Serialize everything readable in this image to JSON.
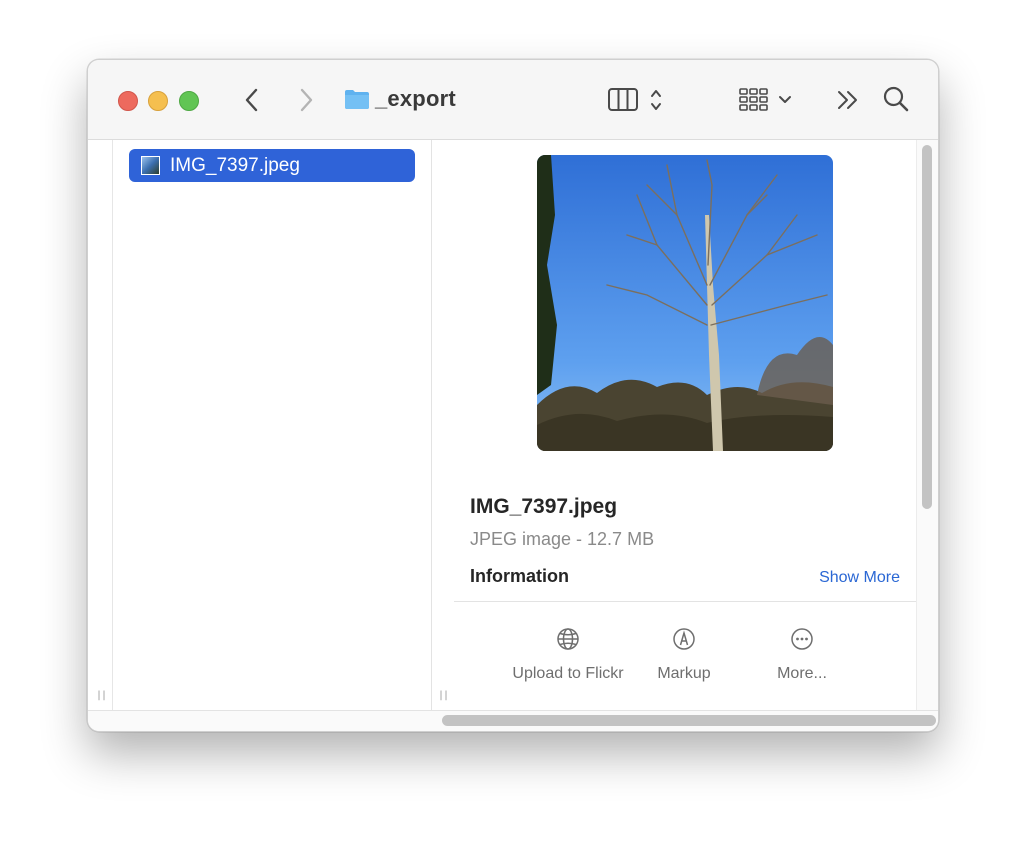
{
  "window": {
    "title": "_export"
  },
  "toolbar": {
    "back_icon": "chevron-left-icon",
    "forward_icon": "chevron-right-icon",
    "folder_icon": "folder-icon",
    "view_icon": "column-view-icon",
    "group_icon": "grid-group-icon",
    "overflow_icon": "double-chevron-right-icon",
    "search_icon": "search-icon"
  },
  "columns": {
    "files": [
      {
        "name": "IMG_7397.jpeg",
        "selected": true
      }
    ]
  },
  "preview": {
    "file_name": "IMG_7397.jpeg",
    "file_meta": "JPEG image - 12.7 MB",
    "info_heading": "Information",
    "show_more": "Show More",
    "actions": [
      {
        "label": "Upload to Flickr",
        "icon": "globe-icon"
      },
      {
        "label": "Markup",
        "icon": "markup-pen-icon"
      },
      {
        "label": "More...",
        "icon": "ellipsis-circle-icon"
      }
    ]
  },
  "colors": {
    "selection": "#2f63d8",
    "link": "#2a67d4",
    "close": "#ed6a5e",
    "minimize": "#f5bf4f",
    "zoom": "#61c554"
  }
}
